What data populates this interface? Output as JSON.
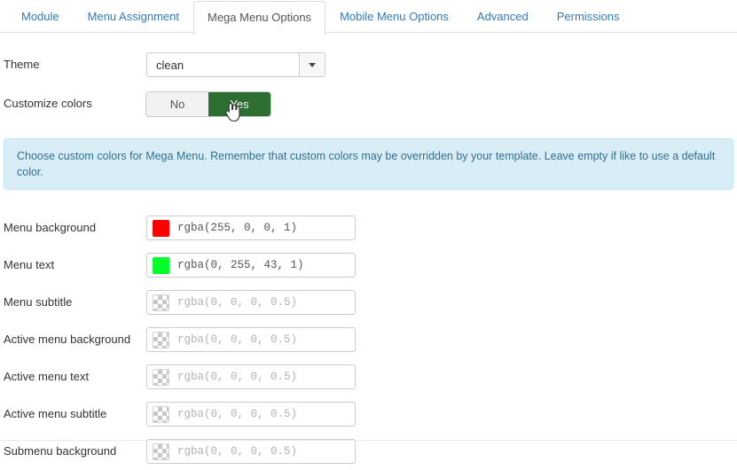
{
  "tabs": [
    {
      "label": "Module",
      "active": false
    },
    {
      "label": "Menu Assignment",
      "active": false
    },
    {
      "label": "Mega Menu Options",
      "active": true
    },
    {
      "label": "Mobile Menu Options",
      "active": false
    },
    {
      "label": "Advanced",
      "active": false
    },
    {
      "label": "Permissions",
      "active": false
    }
  ],
  "theme": {
    "label": "Theme",
    "value": "clean"
  },
  "customize_colors": {
    "label": "Customize colors",
    "options": [
      "No",
      "Yes"
    ],
    "selected": "Yes"
  },
  "alert": {
    "text": "Choose custom colors for Mega Menu. Remember that custom colors may be overridden by your template. Leave empty if like to use a default color."
  },
  "colors": {
    "rows": [
      {
        "label": "Menu background",
        "value": "rgba(255, 0, 0, 1)",
        "empty": false,
        "swatch": "#ff0000"
      },
      {
        "label": "Menu text",
        "value": "rgba(0, 255, 43, 1)",
        "empty": false,
        "swatch": "#00ff2b"
      },
      {
        "label": "Menu subtitle",
        "value": "rgba(0, 0, 0, 0.5)",
        "empty": true,
        "swatch": ""
      },
      {
        "label": "Active menu background",
        "value": "rgba(0, 0, 0, 0.5)",
        "empty": true,
        "swatch": ""
      },
      {
        "label": "Active menu text",
        "value": "rgba(0, 0, 0, 0.5)",
        "empty": true,
        "swatch": ""
      },
      {
        "label": "Active menu subtitle",
        "value": "rgba(0, 0, 0, 0.5)",
        "empty": true,
        "swatch": ""
      },
      {
        "label": "Submenu background",
        "value": "rgba(0, 0, 0, 0.5)",
        "empty": true,
        "swatch": ""
      }
    ]
  },
  "theme_colors": {
    "active_toggle_green": "#2d6e33",
    "tab_link_blue": "#337ab7",
    "alert_bg": "#d9edf7",
    "alert_border": "#bce8f1",
    "alert_text": "#31708f"
  },
  "icons": {
    "caret_down": "chevron-down-icon",
    "cursor": "pointer-hand-cursor"
  }
}
